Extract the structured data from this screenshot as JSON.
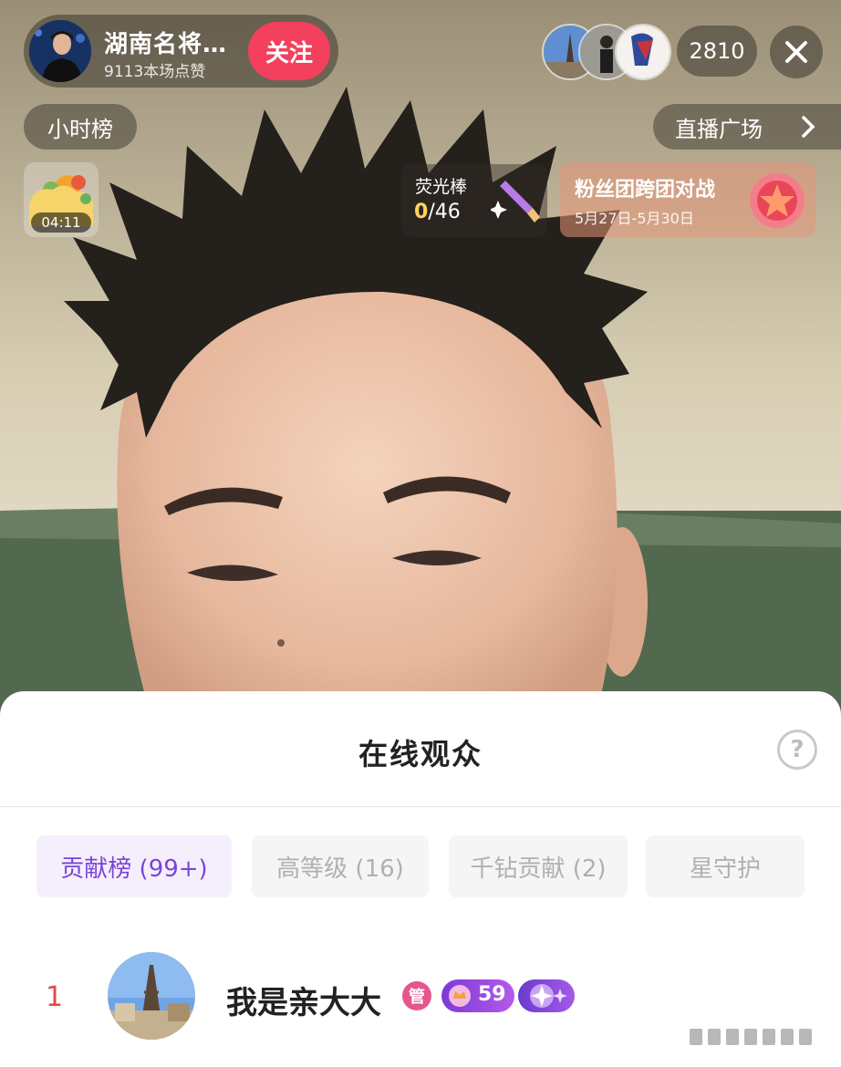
{
  "colors": {
    "follow": "#f3405c",
    "accent_purple": "#7a45d8",
    "rank_red": "#e24a4a",
    "admin_badge": "#e5568f"
  },
  "header": {
    "host_name": "湖南名将…",
    "host_likes": "9113本场点赞",
    "follow_label": "关注",
    "viewer_count": "2810",
    "close_icon": "close-icon"
  },
  "nav": {
    "hour_rank": "小时榜",
    "live_square": "直播广场"
  },
  "widgets": {
    "timer": "04:11",
    "glowstick_title": "荧光棒",
    "glowstick_current": "0",
    "glowstick_total": "/46",
    "battle_title": "粉丝团跨团对战",
    "battle_dates": "5月27日-5月30日"
  },
  "sheet": {
    "title": "在线观众",
    "help_icon": "question-icon",
    "help_glyph": "?",
    "tabs": [
      {
        "label": "贡献榜 (99+)",
        "active": true
      },
      {
        "label": "高等级 (16)",
        "active": false
      },
      {
        "label": "千钻贡献 (2)",
        "active": false
      },
      {
        "label": "星守护",
        "active": false
      }
    ],
    "rows": [
      {
        "rank": "1",
        "name": "我是亲大大",
        "admin_badge": "管",
        "level": "59"
      }
    ]
  }
}
